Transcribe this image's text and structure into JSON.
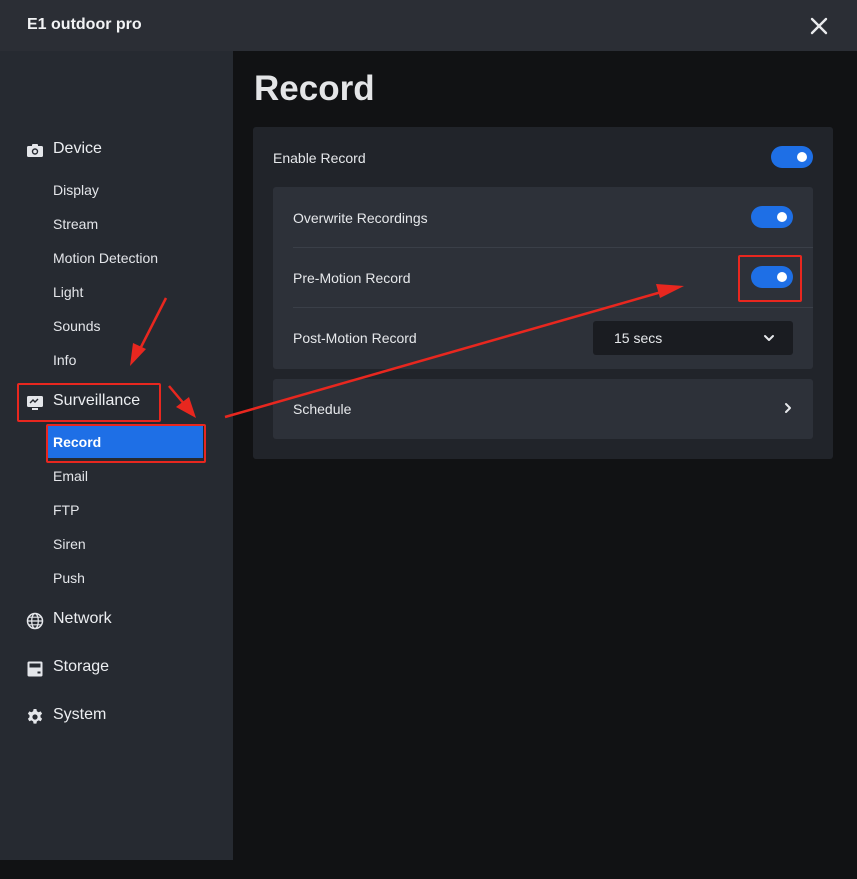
{
  "window": {
    "title": "E1 outdoor pro"
  },
  "sidebar": {
    "sections": [
      {
        "label": "Device",
        "icon": "camera-icon"
      },
      {
        "label": "Surveillance",
        "icon": "monitor-icon"
      },
      {
        "label": "Network",
        "icon": "globe-icon"
      },
      {
        "label": "Storage",
        "icon": "storage-icon"
      },
      {
        "label": "System",
        "icon": "gear-icon"
      }
    ],
    "device_items": [
      "Display",
      "Stream",
      "Motion Detection",
      "Light",
      "Sounds",
      "Info"
    ],
    "surveillance_items": [
      "Record",
      "Email",
      "FTP",
      "Siren",
      "Push"
    ],
    "active_item": "Record"
  },
  "main": {
    "title": "Record",
    "enable_record": {
      "label": "Enable Record",
      "on": true
    },
    "overwrite_recordings": {
      "label": "Overwrite Recordings",
      "on": true
    },
    "pre_motion_record": {
      "label": "Pre-Motion Record",
      "on": true
    },
    "post_motion_record": {
      "label": "Post-Motion Record",
      "value": "15 secs"
    },
    "schedule": {
      "label": "Schedule"
    }
  },
  "colors": {
    "accent": "#1e6fe6",
    "annotation": "#e8271f",
    "titlebar": "#2b2e35",
    "sidebar": "#262a31",
    "background": "#111214"
  }
}
